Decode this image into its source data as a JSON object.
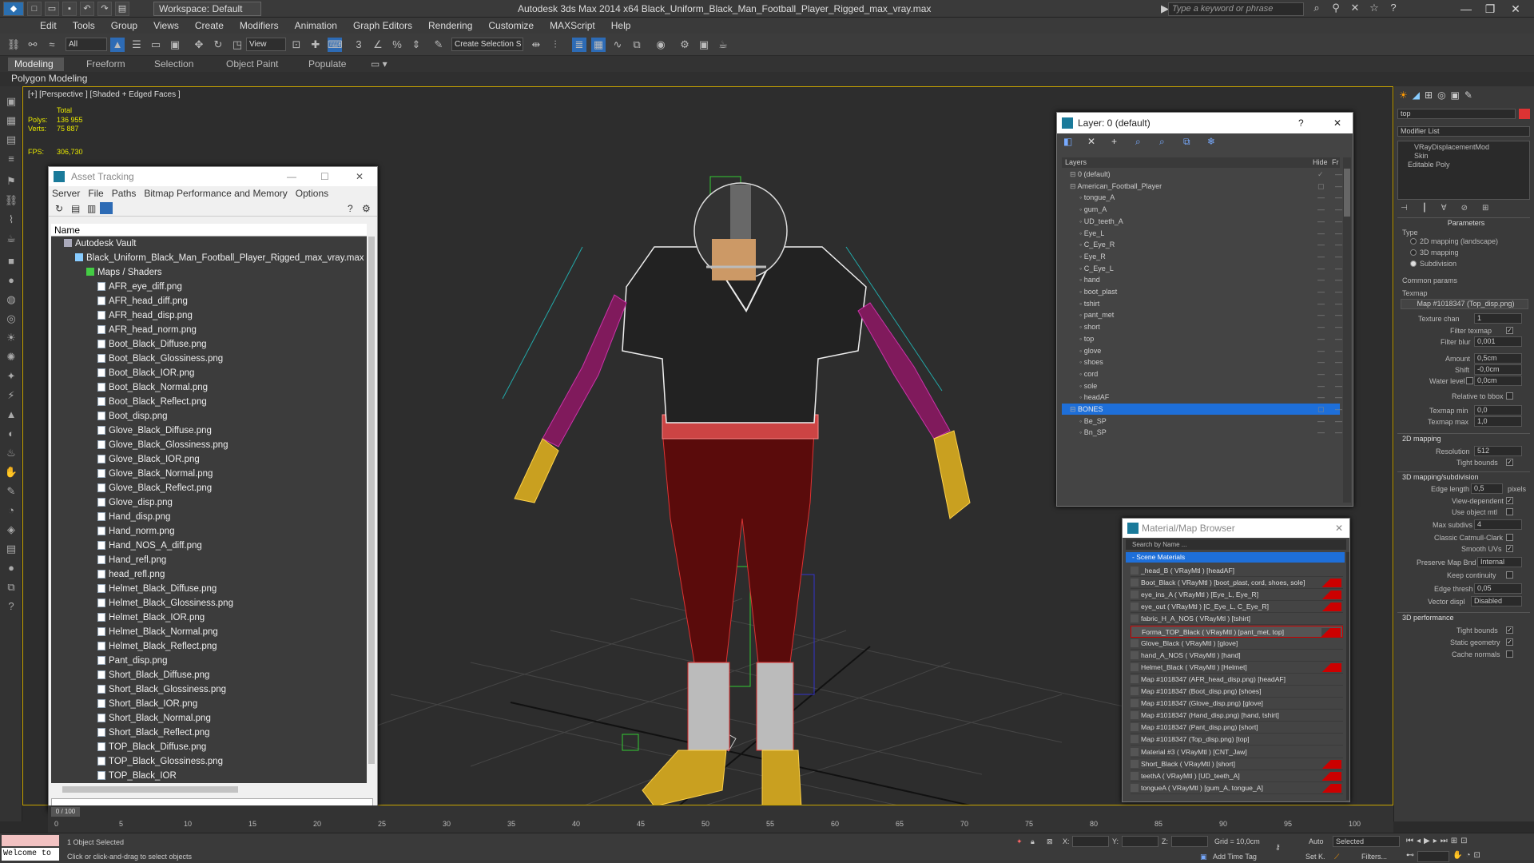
{
  "titlebar": {
    "workspace": "Workspace: Default",
    "app_title": "Autodesk 3ds Max  2014 x64     Black_Uniform_Black_Man_Football_Player_Rigged_max_vray.max",
    "search_placeholder": "Type a keyword or phrase"
  },
  "menu": [
    "Edit",
    "Tools",
    "Group",
    "Views",
    "Create",
    "Modifiers",
    "Animation",
    "Graph Editors",
    "Rendering",
    "Customize",
    "MAXScript",
    "Help"
  ],
  "toolbar": {
    "filter": "All",
    "refcoord": "View",
    "named_sel": "Create Selection S"
  },
  "ribbon": {
    "tabs": [
      "Modeling",
      "Freeform",
      "Selection",
      "Object Paint",
      "Populate"
    ],
    "subtab": "Polygon Modeling"
  },
  "viewport": {
    "label": "[+] [Perspective ] [Shaded + Edged Faces ]",
    "stats": {
      "total": "Total",
      "polys_label": "Polys:",
      "polys": "136 955",
      "verts_label": "Verts:",
      "verts": "75 887",
      "fps_label": "FPS:",
      "fps": "306,730"
    }
  },
  "asset": {
    "title": "Asset Tracking",
    "menu": [
      "Server",
      "File",
      "Paths",
      "Bitmap Performance and Memory",
      "Options"
    ],
    "col_name": "Name",
    "vault": "Autodesk Vault",
    "file": "Black_Uniform_Black_Man_Football_Player_Rigged_max_vray.max",
    "maps": "Maps / Shaders",
    "items": [
      "AFR_eye_diff.png",
      "AFR_head_diff.png",
      "AFR_head_disp.png",
      "AFR_head_norm.png",
      "Boot_Black_Diffuse.png",
      "Boot_Black_Glossiness.png",
      "Boot_Black_IOR.png",
      "Boot_Black_Normal.png",
      "Boot_Black_Reflect.png",
      "Boot_disp.png",
      "Glove_Black_Diffuse.png",
      "Glove_Black_Glossiness.png",
      "Glove_Black_IOR.png",
      "Glove_Black_Normal.png",
      "Glove_Black_Reflect.png",
      "Glove_disp.png",
      "Hand_disp.png",
      "Hand_norm.png",
      "Hand_NOS_A_diff.png",
      "Hand_refl.png",
      "head_refl.png",
      "Helmet_Black_Diffuse.png",
      "Helmet_Black_Glossiness.png",
      "Helmet_Black_IOR.png",
      "Helmet_Black_Normal.png",
      "Helmet_Black_Reflect.png",
      "Pant_disp.png",
      "Short_Black_Diffuse.png",
      "Short_Black_Glossiness.png",
      "Short_Black_IOR.png",
      "Short_Black_Normal.png",
      "Short_Black_Reflect.png",
      "TOP_Black_Diffuse.png",
      "TOP_Black_Glossiness.png",
      "TOP_Black_IOR"
    ]
  },
  "layer": {
    "title": "Layer: 0 (default)",
    "help": "?",
    "col_layers": "Layers",
    "col_hide": "Hide",
    "col_fr": "Fr",
    "rows": [
      "0 (default)",
      "American_Football_Player",
      "tongue_A",
      "gum_A",
      "UD_teeth_A",
      "Eye_L",
      "C_Eye_R",
      "Eye_R",
      "C_Eye_L",
      "hand",
      "boot_plast",
      "tshirt",
      "pant_met",
      "short",
      "top",
      "glove",
      "shoes",
      "cord",
      "sole",
      "headAF",
      "BONES",
      "Be_SP",
      "Bn_SP"
    ]
  },
  "matbrowser": {
    "title": "Material/Map Browser",
    "search": "Search by Name ...",
    "section": "- Scene Materials",
    "rows": [
      "_head_B ( VRayMtl ) [headAF]",
      "Boot_Black ( VRayMtl ) [boot_plast, cord, shoes, sole]",
      "eye_ins_A ( VRayMtl ) [Eye_L, Eye_R]",
      "eye_out ( VRayMtl ) [C_Eye_L, C_Eye_R]",
      "fabric_H_A_NOS ( VRayMtl ) [tshirt]",
      "Forma_TOP_Black ( VRayMtl ) [pant_met, top]",
      "Glove_Black ( VRayMtl ) [glove]",
      "hand_A_NOS ( VRayMtl ) [hand]",
      "Helmet_Black ( VRayMtl ) [Helmet]",
      "Map #1018347 (AFR_head_disp.png) [headAF]",
      "Map #1018347 (Boot_disp.png) [shoes]",
      "Map #1018347 (Glove_disp.png) [glove]",
      "Map #1018347 (Hand_disp.png) [hand, tshirt]",
      "Map #1018347 (Pant_disp.png) [short]",
      "Map #1018347 (Top_disp.png) [top]",
      "Material #3 ( VRayMtl ) [CNT_Jaw]",
      "Short_Black ( VRayMtl ) [short]",
      "teethA ( VRayMtl ) [UD_teeth_A]",
      "tongueA ( VRayMtl ) [gum_A, tongue_A]"
    ]
  },
  "cmdpanel": {
    "name": "top",
    "modlist": "Modifier List",
    "stack": [
      "VRayDisplacementMod",
      "Skin",
      "Editable Poly"
    ],
    "params": "Parameters",
    "type_lbl": "Type",
    "type_opts": [
      "2D mapping (landscape)",
      "3D mapping",
      "Subdivision"
    ],
    "common": "Common params",
    "texmap_lbl": "Texmap",
    "texmap": "Map #1018347 (Top_disp.png)",
    "texture_chan": "Texture chan",
    "texture_chan_v": "1",
    "filter_texmap": "Filter texmap",
    "filter_blur": "Filter blur",
    "filter_blur_v": "0,001",
    "amount": "Amount",
    "amount_v": "0,5cm",
    "shift": "Shift",
    "shift_v": "-0,0cm",
    "water": "Water level",
    "water_v": "0,0cm",
    "relbox": "Relative to bbox",
    "tmin": "Texmap min",
    "tmin_v": "0,0",
    "tmax": "Texmap max",
    "tmax_v": "1,0",
    "map2d": "2D mapping",
    "resolution": "Resolution",
    "resolution_v": "512",
    "tight": "Tight bounds",
    "map3d": "3D mapping/subdivision",
    "edgelen": "Edge length",
    "edgelen_v": "0,5",
    "pixels": "pixels",
    "viewdep": "View-dependent",
    "useobj": "Use object mtl",
    "maxsub": "Max subdivs",
    "maxsub_v": "4",
    "classic": "Classic Catmull-Clark",
    "smooth": "Smooth UVs",
    "preserve": "Preserve Map Bnd",
    "preserve_v": "Internal",
    "keepcont": "Keep continuity",
    "edgethresh": "Edge thresh",
    "edgethresh_v": "0,05",
    "vecdisp": "Vector displ",
    "vecdisp_v": "Disabled",
    "perf": "3D performance",
    "tight2": "Tight bounds",
    "static": "Static geometry",
    "cache": "Cache normals"
  },
  "timeline": {
    "frame": "0 / 100",
    "ticks": [
      "0",
      "5",
      "10",
      "15",
      "20",
      "25",
      "30",
      "35",
      "40",
      "45",
      "50",
      "55",
      "60",
      "65",
      "70",
      "75",
      "80",
      "85",
      "90",
      "95",
      "100"
    ]
  },
  "status": {
    "welcome": "Welcome to",
    "selected": "1 Object Selected",
    "hint": "Click or click-and-drag to select objects",
    "x": "X:",
    "y": "Y:",
    "z": "Z:",
    "grid": "Grid = 10,0cm",
    "addtime": "Add Time Tag",
    "auto": "Auto",
    "selected_dd": "Selected",
    "setk": "Set K.",
    "filters": "Filters..."
  }
}
